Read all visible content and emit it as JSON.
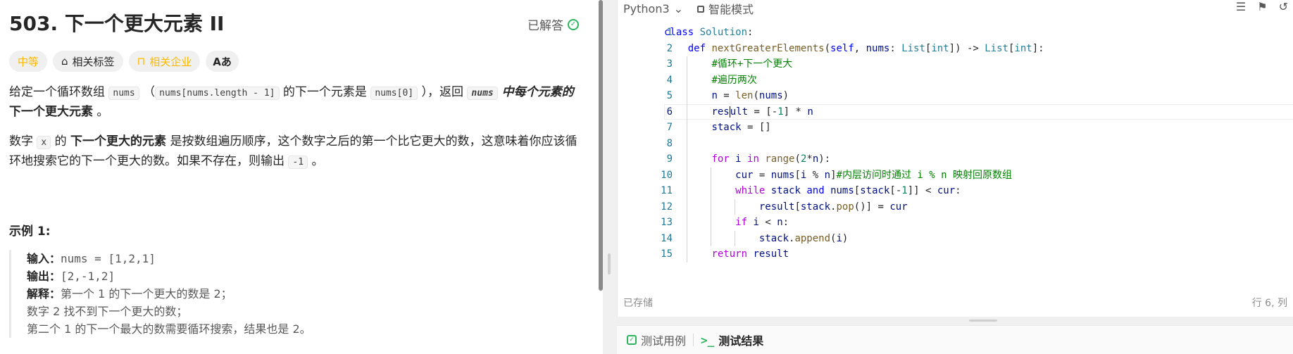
{
  "problem": {
    "title": "503. 下一个更大元素 II",
    "status": "已解答",
    "tags": {
      "difficulty": "中等",
      "related_tags": "相关标签",
      "related_companies": "相关企业",
      "translate": "Aあ"
    },
    "desc": {
      "p1_a": "给定一个循环数组 ",
      "p1_code1": "nums",
      "p1_b": " （",
      "p1_code2": "nums[nums.length - 1]",
      "p1_c": " 的下一个元素是 ",
      "p1_code3": "nums[0]",
      "p1_d": " ），返回 ",
      "p1_code4": "nums",
      "p1_e": " 中每个元素的 ",
      "p1_f": "下一个更大元素",
      "p1_g": " 。",
      "p2_a": "数字 ",
      "p2_code1": "x",
      "p2_b": " 的 ",
      "p2_c": "下一个更大的元素",
      "p2_d": " 是按数组遍历顺序，这个数字之后的第一个比它更大的数，这意味着你应该循环地搜索它的下一个更大的数。如果不存在，则输出 ",
      "p2_code2": "-1",
      "p2_e": " 。"
    },
    "example": {
      "title": "示例 1:",
      "input_label": "输入：",
      "input_value": "nums = [1,2,1]",
      "output_label": "输出：",
      "output_value": "[2,-1,2]",
      "explain_label": "解释：",
      "explain_1": "第一个 1 的下一个更大的数是 2；",
      "explain_2": "数字 2 找不到下一个更大的数；",
      "explain_3": "第二个 1 的下一个最大的数需要循环搜索，结果也是 2。"
    }
  },
  "editor": {
    "language": "Python3",
    "mode": "智能模式",
    "saved": "已存储",
    "position": "行 6, 列",
    "line_numbers": [
      "1",
      "2",
      "3",
      "4",
      "5",
      "6",
      "7",
      "8",
      "9",
      "10",
      "11",
      "12",
      "13",
      "14",
      "15"
    ]
  },
  "tests": {
    "cases": "测试用例",
    "results": "测试结果"
  }
}
